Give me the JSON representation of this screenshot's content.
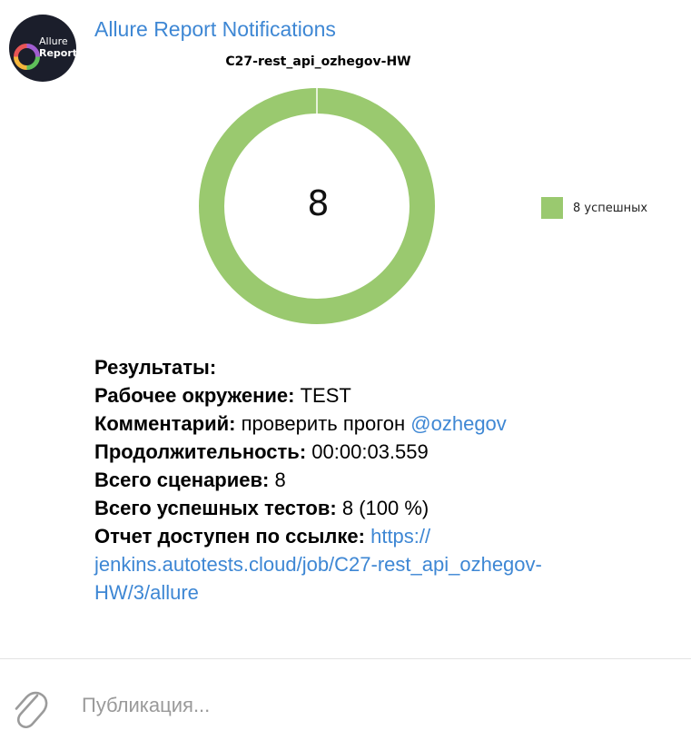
{
  "sender": {
    "name": "Allure Report Notifications",
    "avatar_line1": "Allure",
    "avatar_line2": "Report"
  },
  "chart_data": {
    "type": "pie",
    "title": "C27-rest_api_ozhegov-HW",
    "center_label": "8",
    "series": [
      {
        "name": "8 успешных",
        "value": 8,
        "color": "#9ac96f"
      }
    ],
    "legend_position": "right"
  },
  "results": {
    "heading": "Результаты:",
    "environment_label": "Рабочее окружение:",
    "environment_value": "TEST",
    "comment_label": "Комментарий:",
    "comment_text": "проверить прогон",
    "comment_mention": "@ozhegov",
    "duration_label": "Продолжительность:",
    "duration_value": "00:00:03.559",
    "scenarios_label": "Всего сценариев:",
    "scenarios_value": "8",
    "passed_label": "Всего успешных тестов:",
    "passed_value": "8 (100 %)",
    "report_label": "Отчет доступен по ссылке:",
    "report_link": "https://jenkins.autotests.cloud/job/C27-rest_api_ozhegov-HW/3/allure"
  },
  "composer": {
    "placeholder": "Публикация...",
    "attach_icon": "paperclip-icon"
  }
}
